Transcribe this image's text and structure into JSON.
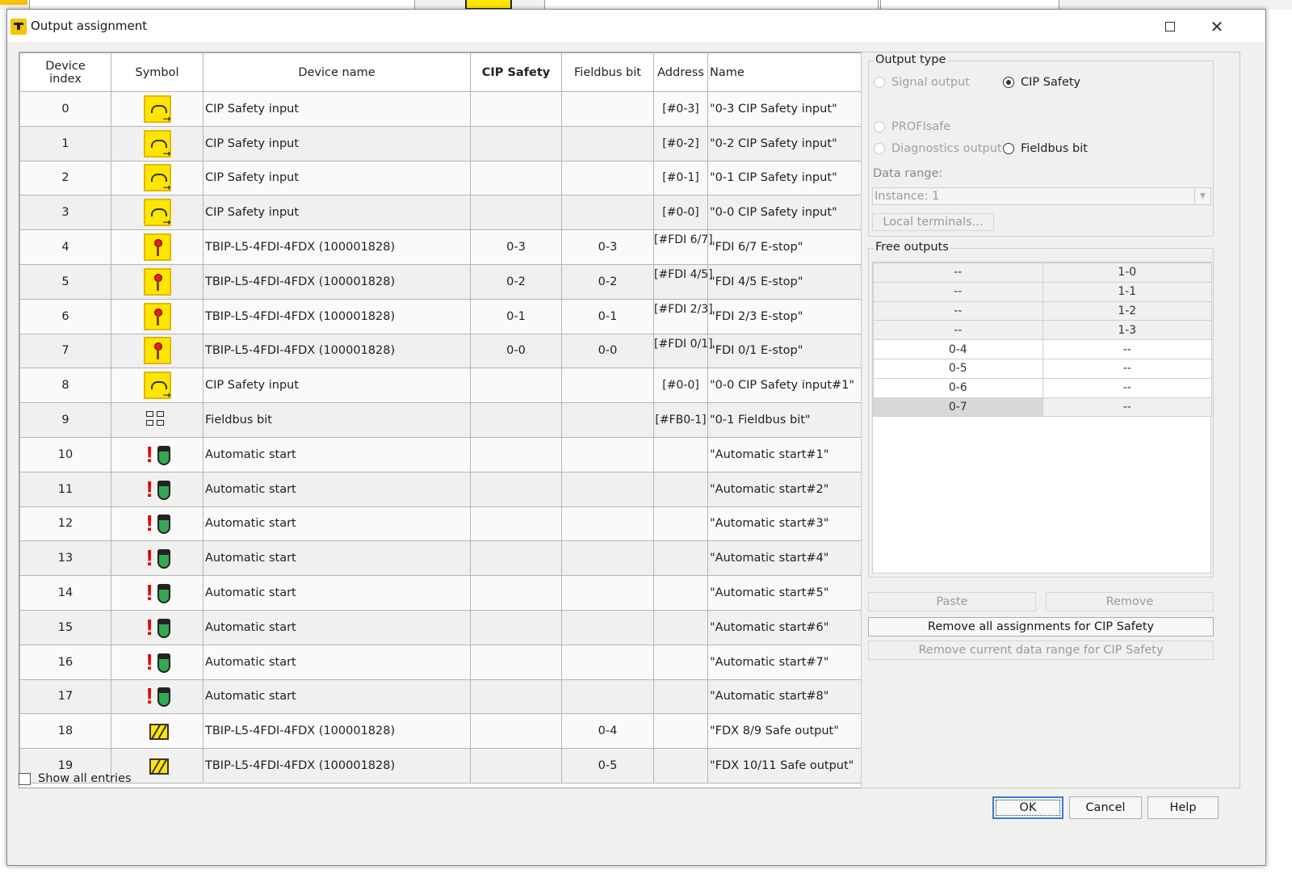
{
  "window": {
    "title": "Output assignment"
  },
  "table": {
    "headers": {
      "device_index_1": "Device",
      "device_index_2": "index",
      "symbol": "Symbol",
      "device_name": "Device name",
      "cip_safety": "CIP Safety",
      "fieldbus_bit": "Fieldbus bit",
      "address": "Address",
      "name": "Name"
    },
    "rows": [
      {
        "index": "0",
        "symbol": "cip-safety-input-icon",
        "device": "CIP Safety input",
        "cip": "",
        "fb": "",
        "address": "[#0-3]",
        "name": "\"0-3 CIP Safety input\""
      },
      {
        "index": "1",
        "symbol": "cip-safety-input-icon",
        "device": "CIP Safety input",
        "cip": "",
        "fb": "",
        "address": "[#0-2]",
        "name": "\"0-2 CIP Safety input\""
      },
      {
        "index": "2",
        "symbol": "cip-safety-input-icon",
        "device": "CIP Safety input",
        "cip": "",
        "fb": "",
        "address": "[#0-1]",
        "name": "\"0-1 CIP Safety input\""
      },
      {
        "index": "3",
        "symbol": "cip-safety-input-icon",
        "device": "CIP Safety input",
        "cip": "",
        "fb": "",
        "address": "[#0-0]",
        "name": "\"0-0 CIP Safety input\""
      },
      {
        "index": "4",
        "symbol": "emergency-stop-icon",
        "device": "TBIP-L5-4FDI-4FDX (100001828)",
        "cip": "0-3",
        "fb": "0-3",
        "address": "[#FDI 6/7]",
        "name": "\"FDI 6/7 E-stop\""
      },
      {
        "index": "5",
        "symbol": "emergency-stop-icon",
        "device": "TBIP-L5-4FDI-4FDX (100001828)",
        "cip": "0-2",
        "fb": "0-2",
        "address": "[#FDI 4/5]",
        "name": "\"FDI 4/5 E-stop\""
      },
      {
        "index": "6",
        "symbol": "emergency-stop-icon",
        "device": "TBIP-L5-4FDI-4FDX (100001828)",
        "cip": "0-1",
        "fb": "0-1",
        "address": "[#FDI 2/3]",
        "name": "\"FDI 2/3 E-stop\""
      },
      {
        "index": "7",
        "symbol": "emergency-stop-icon",
        "device": "TBIP-L5-4FDI-4FDX (100001828)",
        "cip": "0-0",
        "fb": "0-0",
        "address": "[#FDI 0/1]",
        "name": "\"FDI 0/1 E-stop\""
      },
      {
        "index": "8",
        "symbol": "cip-safety-input-icon",
        "device": "CIP Safety input",
        "cip": "",
        "fb": "",
        "address": "[#0-0]",
        "name": "\"0-0 CIP Safety input#1\""
      },
      {
        "index": "9",
        "symbol": "fieldbus-bit-icon",
        "device": "Fieldbus bit",
        "cip": "",
        "fb": "",
        "address": "[#FB0-1]",
        "name": "\"0-1 Fieldbus bit\""
      },
      {
        "index": "10",
        "symbol": "automatic-start-icon",
        "device": "Automatic start",
        "cip": "",
        "fb": "",
        "address": "",
        "name": "\"Automatic start#1\""
      },
      {
        "index": "11",
        "symbol": "automatic-start-icon",
        "device": "Automatic start",
        "cip": "",
        "fb": "",
        "address": "",
        "name": "\"Automatic start#2\""
      },
      {
        "index": "12",
        "symbol": "automatic-start-icon",
        "device": "Automatic start",
        "cip": "",
        "fb": "",
        "address": "",
        "name": "\"Automatic start#3\""
      },
      {
        "index": "13",
        "symbol": "automatic-start-icon",
        "device": "Automatic start",
        "cip": "",
        "fb": "",
        "address": "",
        "name": "\"Automatic start#4\""
      },
      {
        "index": "14",
        "symbol": "automatic-start-icon",
        "device": "Automatic start",
        "cip": "",
        "fb": "",
        "address": "",
        "name": "\"Automatic start#5\""
      },
      {
        "index": "15",
        "symbol": "automatic-start-icon",
        "device": "Automatic start",
        "cip": "",
        "fb": "",
        "address": "",
        "name": "\"Automatic start#6\""
      },
      {
        "index": "16",
        "symbol": "automatic-start-icon",
        "device": "Automatic start",
        "cip": "",
        "fb": "",
        "address": "",
        "name": "\"Automatic start#7\""
      },
      {
        "index": "17",
        "symbol": "automatic-start-icon",
        "device": "Automatic start",
        "cip": "",
        "fb": "",
        "address": "",
        "name": "\"Automatic start#8\""
      },
      {
        "index": "18",
        "symbol": "safe-output-icon",
        "device": "TBIP-L5-4FDI-4FDX (100001828)",
        "cip": "",
        "fb": "0-4",
        "address": "",
        "name": "\"FDX 8/9 Safe output\""
      },
      {
        "index": "19",
        "symbol": "safe-output-icon",
        "device": "TBIP-L5-4FDI-4FDX (100001828)",
        "cip": "",
        "fb": "0-5",
        "address": "",
        "name": "\"FDX 10/11 Safe output\""
      }
    ]
  },
  "output_type": {
    "legend": "Output type",
    "signal_output": "Signal output",
    "cip_safety": "CIP Safety",
    "profisafe": "PROFIsafe",
    "diagnostics_output": "Diagnostics output",
    "fieldbus_bit": "Fieldbus bit",
    "data_range_label": "Data range:",
    "data_range_value": "Instance: 1",
    "local_terminals": "Local terminals..."
  },
  "free_outputs": {
    "legend": "Free outputs",
    "rows": [
      {
        "a": "--",
        "b": "1-0"
      },
      {
        "a": "--",
        "b": "1-1"
      },
      {
        "a": "--",
        "b": "1-2"
      },
      {
        "a": "--",
        "b": "1-3"
      },
      {
        "a": "0-4",
        "b": "--"
      },
      {
        "a": "0-5",
        "b": "--"
      },
      {
        "a": "0-6",
        "b": "--"
      },
      {
        "a": "0-7",
        "b": "--"
      }
    ]
  },
  "buttons": {
    "paste": "Paste",
    "remove": "Remove",
    "remove_all": "Remove all assignments for CIP Safety",
    "remove_current": "Remove current data range for CIP Safety",
    "ok": "OK",
    "cancel": "Cancel",
    "help": "Help"
  },
  "show_all_entries": "Show all entries"
}
